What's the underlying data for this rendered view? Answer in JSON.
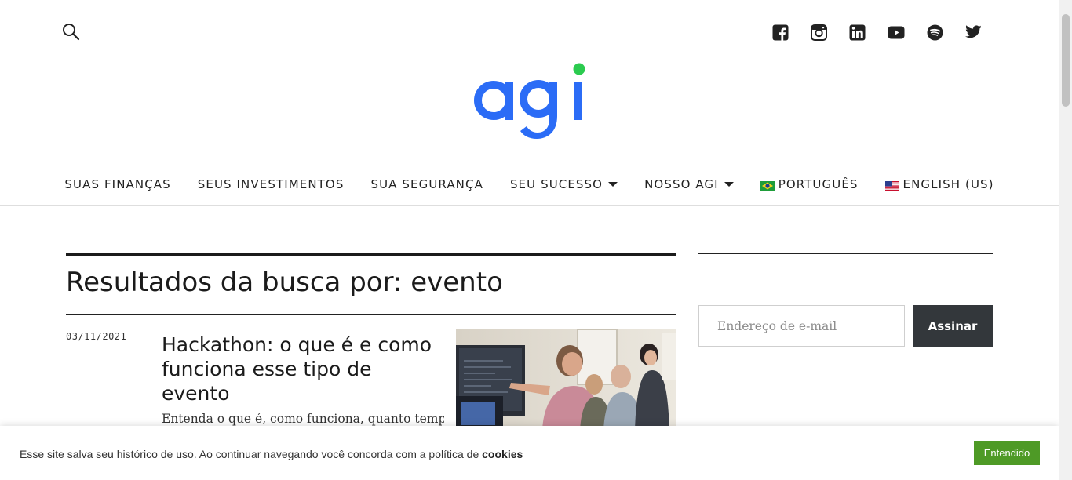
{
  "header": {
    "search_icon": "search-icon",
    "social": [
      {
        "name": "facebook-icon"
      },
      {
        "name": "instagram-icon"
      },
      {
        "name": "linkedin-icon"
      },
      {
        "name": "youtube-icon"
      },
      {
        "name": "spotify-icon"
      },
      {
        "name": "twitter-icon"
      }
    ],
    "logo_text": "agi",
    "logo_color": "#2b6cf6",
    "logo_dot_color": "#2bcb4f"
  },
  "nav": {
    "items": [
      {
        "label": "SUAS FINANÇAS"
      },
      {
        "label": "SEUS INVESTIMENTOS"
      },
      {
        "label": "SUA SEGURANÇA"
      },
      {
        "label": "SEU SUCESSO",
        "dropdown": true
      },
      {
        "label": "NOSSO AGI",
        "dropdown": true
      },
      {
        "label": "PORTUGUÊS",
        "flag": "brazil-flag-icon"
      },
      {
        "label": "ENGLISH (US)",
        "flag": "us-flag-icon"
      }
    ]
  },
  "main": {
    "title": "Resultados da busca por: evento",
    "article": {
      "date": "03/11/2021",
      "headline": "Hackathon: o que é e como funciona esse tipo de evento",
      "excerpt": "Entenda o que é, como funciona, quanto tempo"
    }
  },
  "sidebar": {
    "email_placeholder": "Endereço de e-mail",
    "subscribe_label": "Assinar"
  },
  "cookie": {
    "message": "Esse site salva seu histórico de uso. Ao continuar navegando você concorda com a política de ",
    "link": "cookies",
    "button": "Entendido",
    "button_color": "#4e9a26"
  }
}
